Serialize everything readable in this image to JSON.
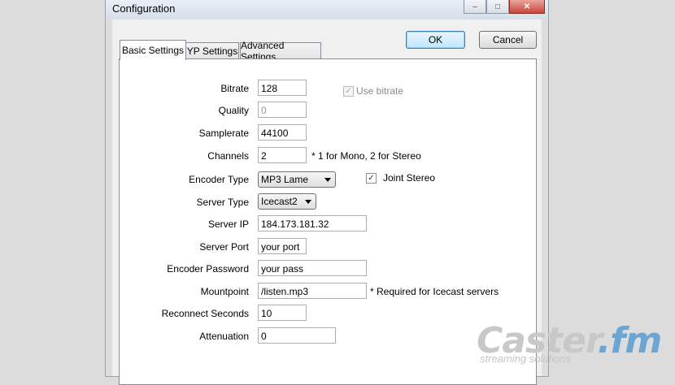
{
  "window": {
    "title": "Configuration",
    "minimize": "–",
    "maximize": "□",
    "close": "✕"
  },
  "buttons": {
    "ok": "OK",
    "cancel": "Cancel"
  },
  "tabs": [
    "Basic Settings",
    "YP Settings",
    "Advanced Settings"
  ],
  "form": {
    "bitrate": {
      "label": "Bitrate",
      "value": "128"
    },
    "quality": {
      "label": "Quality",
      "value": "0"
    },
    "samplerate": {
      "label": "Samplerate",
      "value": "44100"
    },
    "channels": {
      "label": "Channels",
      "value": "2",
      "note": "* 1 for Mono, 2 for Stereo"
    },
    "encoder_type": {
      "label": "Encoder Type",
      "value": "MP3 Lame"
    },
    "server_type": {
      "label": "Server Type",
      "value": "Icecast2"
    },
    "server_ip": {
      "label": "Server IP",
      "value": "184.173.181.32"
    },
    "server_port": {
      "label": "Server Port",
      "value": "your port"
    },
    "encoder_password": {
      "label": "Encoder Password",
      "value": "your pass"
    },
    "mountpoint": {
      "label": "Mountpoint",
      "value": "/listen.mp3",
      "note": "* Required for Icecast servers"
    },
    "reconnect_seconds": {
      "label": "Reconnect Seconds",
      "value": "10"
    },
    "attenuation": {
      "label": "Attenuation",
      "value": "0"
    }
  },
  "checkboxes": {
    "use_bitrate": {
      "label": "Use bitrate",
      "checked": true,
      "enabled": false
    },
    "joint_stereo": {
      "label": "Joint Stereo",
      "checked": true,
      "enabled": true
    }
  },
  "watermark": {
    "main": "Caster",
    "fm": ".fm",
    "sub": "streaming solutions"
  }
}
